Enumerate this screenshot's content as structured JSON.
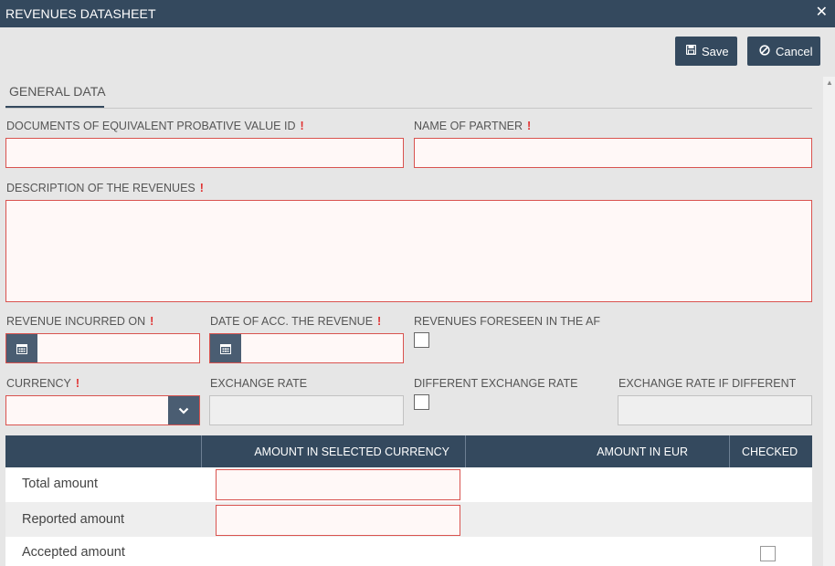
{
  "window": {
    "title": "REVENUES DATASHEET",
    "close_glyph": "✕"
  },
  "toolbar": {
    "save_label": "Save",
    "cancel_label": "Cancel"
  },
  "tabs": [
    {
      "label": "GENERAL DATA",
      "active": true
    }
  ],
  "form": {
    "required_mark": "!",
    "doc_id_label": "DOCUMENTS OF EQUIVALENT PROBATIVE VALUE ID",
    "doc_id_value": "",
    "partner_label": "NAME OF PARTNER",
    "partner_value": "",
    "description_label": "DESCRIPTION OF THE REVENUES",
    "description_value": "",
    "incurred_label": "REVENUE INCURRED ON",
    "incurred_value": "",
    "acc_date_label": "DATE OF ACC. THE REVENUE",
    "acc_date_value": "",
    "foreseen_label": "REVENUES FORESEEN IN THE AF",
    "foreseen_checked": false,
    "currency_label": "CURRENCY",
    "currency_value": "",
    "exchange_rate_label": "EXCHANGE RATE",
    "exchange_rate_value": "",
    "diff_rate_label": "DIFFERENT EXCHANGE RATE",
    "diff_rate_checked": false,
    "rate_if_diff_label": "EXCHANGE RATE IF DIFFERENT",
    "rate_if_diff_value": ""
  },
  "table": {
    "headers": [
      "",
      "AMOUNT IN SELECTED CURRENCY",
      "AMOUNT IN EUR",
      "CHECKED"
    ],
    "rows": [
      {
        "label": "Total amount",
        "amount_selected": "",
        "amount_eur": "",
        "checked": null
      },
      {
        "label": "Reported amount",
        "amount_selected": "",
        "amount_eur": "",
        "checked": null
      },
      {
        "label": "Accepted amount",
        "amount_selected": "",
        "amount_eur": "",
        "checked": false
      }
    ]
  },
  "icons": {
    "save": "floppy-disk-icon",
    "cancel": "ban-icon",
    "calendar": "calendar-icon",
    "dropdown": "chevron-down-icon",
    "close": "close-icon"
  },
  "colors": {
    "header_bg": "#34495e",
    "required": "#e03030",
    "invalid_border": "#d9534f",
    "invalid_bg": "#fff8f7",
    "page_bg": "#e6e6e6"
  }
}
